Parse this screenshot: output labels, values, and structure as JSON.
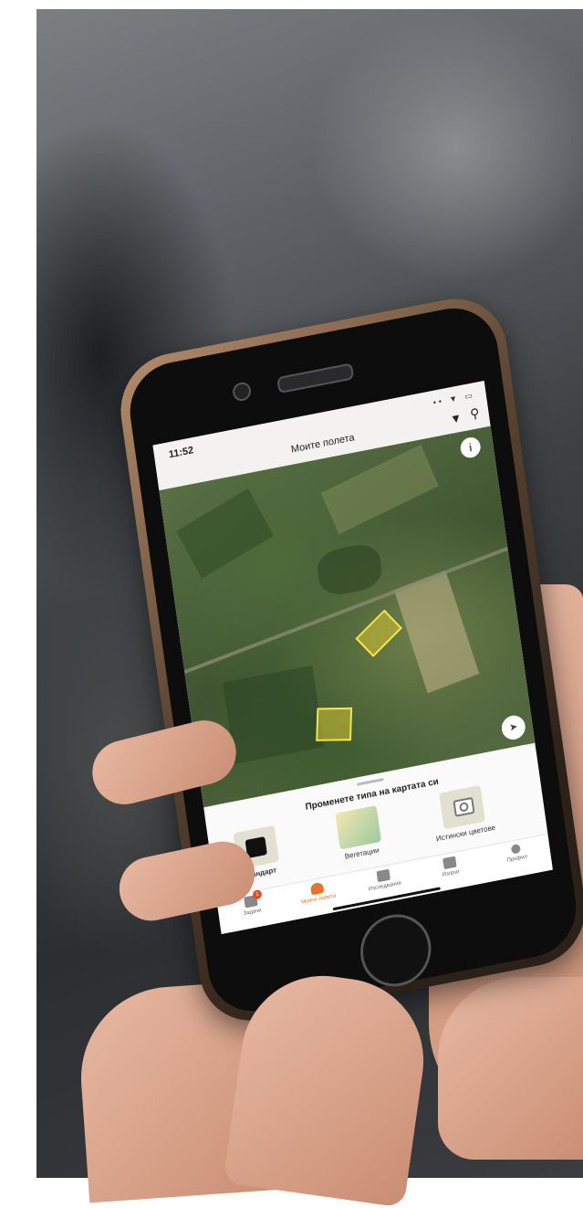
{
  "photo": {
    "description_colors": {
      "background_dark": "#2c2e31",
      "skin": "#e8b9a3",
      "phone_case": "#b48c6c"
    }
  },
  "status_bar": {
    "time": "11:52",
    "icons": "•• ▼ ▭"
  },
  "app_bar": {
    "title": "Моите полета",
    "filter_icon": "filter-icon",
    "search_icon": "search-icon"
  },
  "map": {
    "info_label": "i",
    "locate_label": "➤",
    "highlight_color": "#f2e64b"
  },
  "map_type_sheet": {
    "title": "Променете типа на картата си",
    "options": [
      {
        "label": "Стандарт",
        "selected": true
      },
      {
        "label": "Вегетации",
        "selected": false
      },
      {
        "label": "Истински цветове",
        "selected": false
      }
    ]
  },
  "bottom_nav": {
    "accent_color": "#e8712b",
    "items": [
      {
        "label": "Задачи",
        "badge": "1"
      },
      {
        "label": "Моите полета",
        "active": true
      },
      {
        "label": "Изследвания"
      },
      {
        "label": "Изпрат"
      },
      {
        "label": "Профил"
      }
    ]
  }
}
